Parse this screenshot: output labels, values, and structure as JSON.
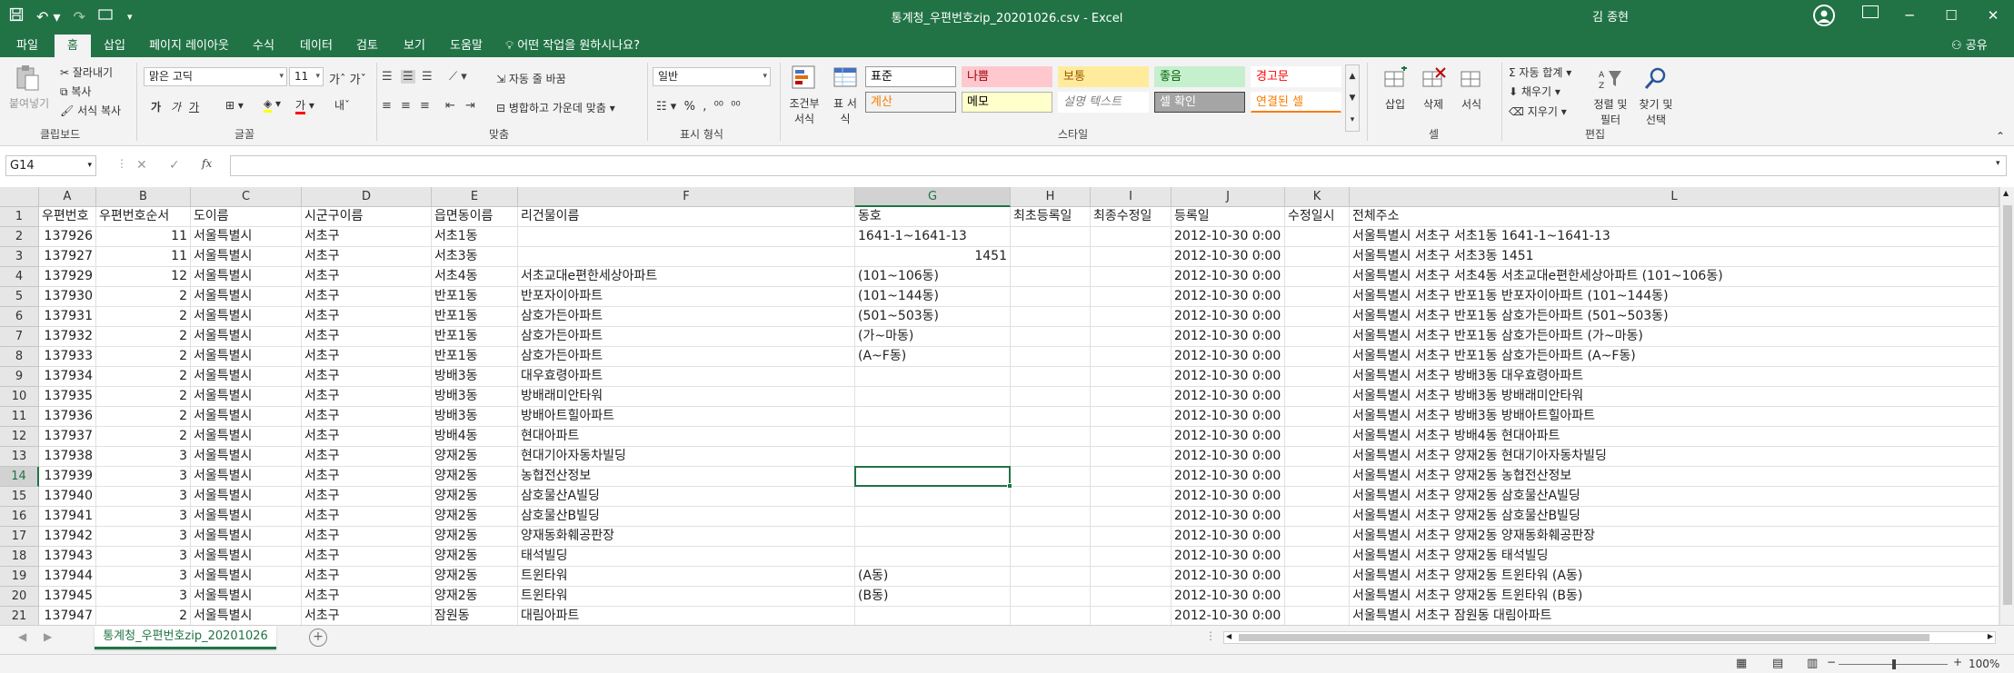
{
  "window": {
    "title": "통계청_우편번호zip_20201026.csv  -  Excel",
    "user": "김 종현",
    "minimize": "─",
    "maximize": "☐",
    "close": "✕"
  },
  "menu": {
    "tabs": [
      "파일",
      "홈",
      "삽입",
      "페이지 레이아웃",
      "수식",
      "데이터",
      "검토",
      "보기",
      "도움말"
    ],
    "active": "홈",
    "tell_me": "어떤 작업을 원하시나요?",
    "share": "공유"
  },
  "ribbon": {
    "clipboard": {
      "paste": "붙여넣기",
      "cut": "잘라내기",
      "copy": "복사",
      "format_painter": "서식 복사",
      "label": "클립보드"
    },
    "font": {
      "name": "맑은 고딕",
      "size": "11",
      "bold": "가",
      "italic": "가",
      "underline": "가",
      "label": "글꼴"
    },
    "align": {
      "wrap": "자동 줄 바꿈",
      "merge": "병합하고 가운데 맞춤",
      "label": "맞춤"
    },
    "number": {
      "format": "일반",
      "label": "표시 형식"
    },
    "styles": {
      "cond_format": "조건부 서식",
      "table_format": "표 서식",
      "cells": [
        {
          "text": "표준",
          "bg": "#ffffff",
          "fg": "#000000",
          "border": "#999999"
        },
        {
          "text": "나쁨",
          "bg": "#ffc7ce",
          "fg": "#9c0006",
          "border": "#ffc7ce"
        },
        {
          "text": "보통",
          "bg": "#ffeb9c",
          "fg": "#9c5700",
          "border": "#ffeb9c"
        },
        {
          "text": "좋음",
          "bg": "#c6efce",
          "fg": "#006100",
          "border": "#c6efce"
        },
        {
          "text": "경고문",
          "bg": "#ffffff",
          "fg": "#ff0000",
          "border": "#ffffff"
        },
        {
          "text": "계산",
          "bg": "#f2f2f2",
          "fg": "#fa7d00",
          "border": "#7f7f7f"
        },
        {
          "text": "메모",
          "bg": "#ffffcc",
          "fg": "#000000",
          "border": "#b2b2b2"
        },
        {
          "text": "설명 텍스트",
          "bg": "#ffffff",
          "fg": "#7f7f7f",
          "border": "#ffffff"
        },
        {
          "text": "셀 확인",
          "bg": "#a5a5a5",
          "fg": "#ffffff",
          "border": "#3f3f3f"
        },
        {
          "text": "연결된 셀",
          "bg": "#ffffff",
          "fg": "#fa7d00",
          "border": "#ffffff"
        }
      ],
      "label": "스타일"
    },
    "cells": {
      "insert": "삽입",
      "delete": "삭제",
      "format": "서식",
      "label": "셀"
    },
    "editing": {
      "autosum": "자동 합계",
      "fill": "채우기",
      "clear": "지우기",
      "sort": "정렬 및 필터",
      "find": "찾기 및 선택",
      "label": "편집"
    }
  },
  "formula_bar": {
    "name_box": "G14",
    "fx": "fx",
    "value": ""
  },
  "sheet": {
    "columns": [
      "A",
      "B",
      "C",
      "D",
      "E",
      "F",
      "G",
      "H",
      "I",
      "J",
      "K",
      "L"
    ],
    "selected_column": "G",
    "selected_row": "14",
    "rows": [
      {
        "n": "1",
        "c": [
          "우편번호",
          "우편번호순서",
          "도이름",
          "시군구이름",
          "읍면동이름",
          "리건물이름",
          "동호",
          "최초등록일",
          "최종수정일",
          "등록일",
          "수정일시",
          "전체주소"
        ]
      },
      {
        "n": "2",
        "c": [
          "137926",
          "11",
          "서울특별시",
          "서초구",
          "서초1동",
          "",
          "1641-1~1641-13",
          "",
          "",
          "2012-10-30 0:00",
          "",
          "서울특별시 서초구 서초1동 1641-1~1641-13"
        ]
      },
      {
        "n": "3",
        "c": [
          "137927",
          "11",
          "서울특별시",
          "서초구",
          "서초3동",
          "",
          "1451",
          "",
          "",
          "2012-10-30 0:00",
          "",
          "서울특별시 서초구 서초3동 1451"
        ]
      },
      {
        "n": "4",
        "c": [
          "137929",
          "12",
          "서울특별시",
          "서초구",
          "서초4동",
          "서초교대e편한세상아파트",
          "(101~106동)",
          "",
          "",
          "2012-10-30 0:00",
          "",
          "서울특별시 서초구 서초4동 서초교대e편한세상아파트 (101~106동)"
        ]
      },
      {
        "n": "5",
        "c": [
          "137930",
          "2",
          "서울특별시",
          "서초구",
          "반포1동",
          "반포자이아파트",
          "(101~144동)",
          "",
          "",
          "2012-10-30 0:00",
          "",
          "서울특별시 서초구 반포1동 반포자이아파트 (101~144동)"
        ]
      },
      {
        "n": "6",
        "c": [
          "137931",
          "2",
          "서울특별시",
          "서초구",
          "반포1동",
          "삼호가든아파트",
          "(501~503동)",
          "",
          "",
          "2012-10-30 0:00",
          "",
          "서울특별시 서초구 반포1동 삼호가든아파트 (501~503동)"
        ]
      },
      {
        "n": "7",
        "c": [
          "137932",
          "2",
          "서울특별시",
          "서초구",
          "반포1동",
          "삼호가든아파트",
          "(가~마동)",
          "",
          "",
          "2012-10-30 0:00",
          "",
          "서울특별시 서초구 반포1동 삼호가든아파트 (가~마동)"
        ]
      },
      {
        "n": "8",
        "c": [
          "137933",
          "2",
          "서울특별시",
          "서초구",
          "반포1동",
          "삼호가든아파트",
          "(A~F동)",
          "",
          "",
          "2012-10-30 0:00",
          "",
          "서울특별시 서초구 반포1동 삼호가든아파트 (A~F동)"
        ]
      },
      {
        "n": "9",
        "c": [
          "137934",
          "2",
          "서울특별시",
          "서초구",
          "방배3동",
          "대우효령아파트",
          "",
          "",
          "",
          "2012-10-30 0:00",
          "",
          "서울특별시 서초구 방배3동 대우효령아파트"
        ]
      },
      {
        "n": "10",
        "c": [
          "137935",
          "2",
          "서울특별시",
          "서초구",
          "방배3동",
          "방배래미안타워",
          "",
          "",
          "",
          "2012-10-30 0:00",
          "",
          "서울특별시 서초구 방배3동 방배래미안타워"
        ]
      },
      {
        "n": "11",
        "c": [
          "137936",
          "2",
          "서울특별시",
          "서초구",
          "방배3동",
          "방배아트힐아파트",
          "",
          "",
          "",
          "2012-10-30 0:00",
          "",
          "서울특별시 서초구 방배3동 방배아트힐아파트"
        ]
      },
      {
        "n": "12",
        "c": [
          "137937",
          "2",
          "서울특별시",
          "서초구",
          "방배4동",
          "현대아파트",
          "",
          "",
          "",
          "2012-10-30 0:00",
          "",
          "서울특별시 서초구 방배4동 현대아파트"
        ]
      },
      {
        "n": "13",
        "c": [
          "137938",
          "3",
          "서울특별시",
          "서초구",
          "양재2동",
          "현대기아자동차빌딩",
          "",
          "",
          "",
          "2012-10-30 0:00",
          "",
          "서울특별시 서초구 양재2동 현대기아자동차빌딩"
        ]
      },
      {
        "n": "14",
        "c": [
          "137939",
          "3",
          "서울특별시",
          "서초구",
          "양재2동",
          "농협전산정보",
          "",
          "",
          "",
          "2012-10-30 0:00",
          "",
          "서울특별시 서초구 양재2동 농협전산정보"
        ]
      },
      {
        "n": "15",
        "c": [
          "137940",
          "3",
          "서울특별시",
          "서초구",
          "양재2동",
          "삼호물산A빌딩",
          "",
          "",
          "",
          "2012-10-30 0:00",
          "",
          "서울특별시 서초구 양재2동 삼호물산A빌딩"
        ]
      },
      {
        "n": "16",
        "c": [
          "137941",
          "3",
          "서울특별시",
          "서초구",
          "양재2동",
          "삼호물산B빌딩",
          "",
          "",
          "",
          "2012-10-30 0:00",
          "",
          "서울특별시 서초구 양재2동 삼호물산B빌딩"
        ]
      },
      {
        "n": "17",
        "c": [
          "137942",
          "3",
          "서울특별시",
          "서초구",
          "양재2동",
          "양재동화훼공판장",
          "",
          "",
          "",
          "2012-10-30 0:00",
          "",
          "서울특별시 서초구 양재2동 양재동화훼공판장"
        ]
      },
      {
        "n": "18",
        "c": [
          "137943",
          "3",
          "서울특별시",
          "서초구",
          "양재2동",
          "태석빌딩",
          "",
          "",
          "",
          "2012-10-30 0:00",
          "",
          "서울특별시 서초구 양재2동 태석빌딩"
        ]
      },
      {
        "n": "19",
        "c": [
          "137944",
          "3",
          "서울특별시",
          "서초구",
          "양재2동",
          "트윈타워",
          "(A동)",
          "",
          "",
          "2012-10-30 0:00",
          "",
          "서울특별시 서초구 양재2동 트윈타워 (A동)"
        ]
      },
      {
        "n": "20",
        "c": [
          "137945",
          "3",
          "서울특별시",
          "서초구",
          "양재2동",
          "트윈타워",
          "(B동)",
          "",
          "",
          "2012-10-30 0:00",
          "",
          "서울특별시 서초구 양재2동 트윈타워 (B동)"
        ]
      },
      {
        "n": "21",
        "c": [
          "137947",
          "2",
          "서울특별시",
          "서초구",
          "잠원동",
          "대림아파트",
          "",
          "",
          "",
          "2012-10-30 0:00",
          "",
          "서울특별시 서초구 잠원동 대림아파트"
        ]
      }
    ],
    "numeric_cols": [
      0,
      1
    ],
    "right_align_cells": [
      [
        "3",
        6
      ]
    ]
  },
  "sheet_tab": "통계청_우편번호zip_20201026",
  "status": {
    "zoom": "100%"
  },
  "colors": {
    "accent": "#217346"
  }
}
